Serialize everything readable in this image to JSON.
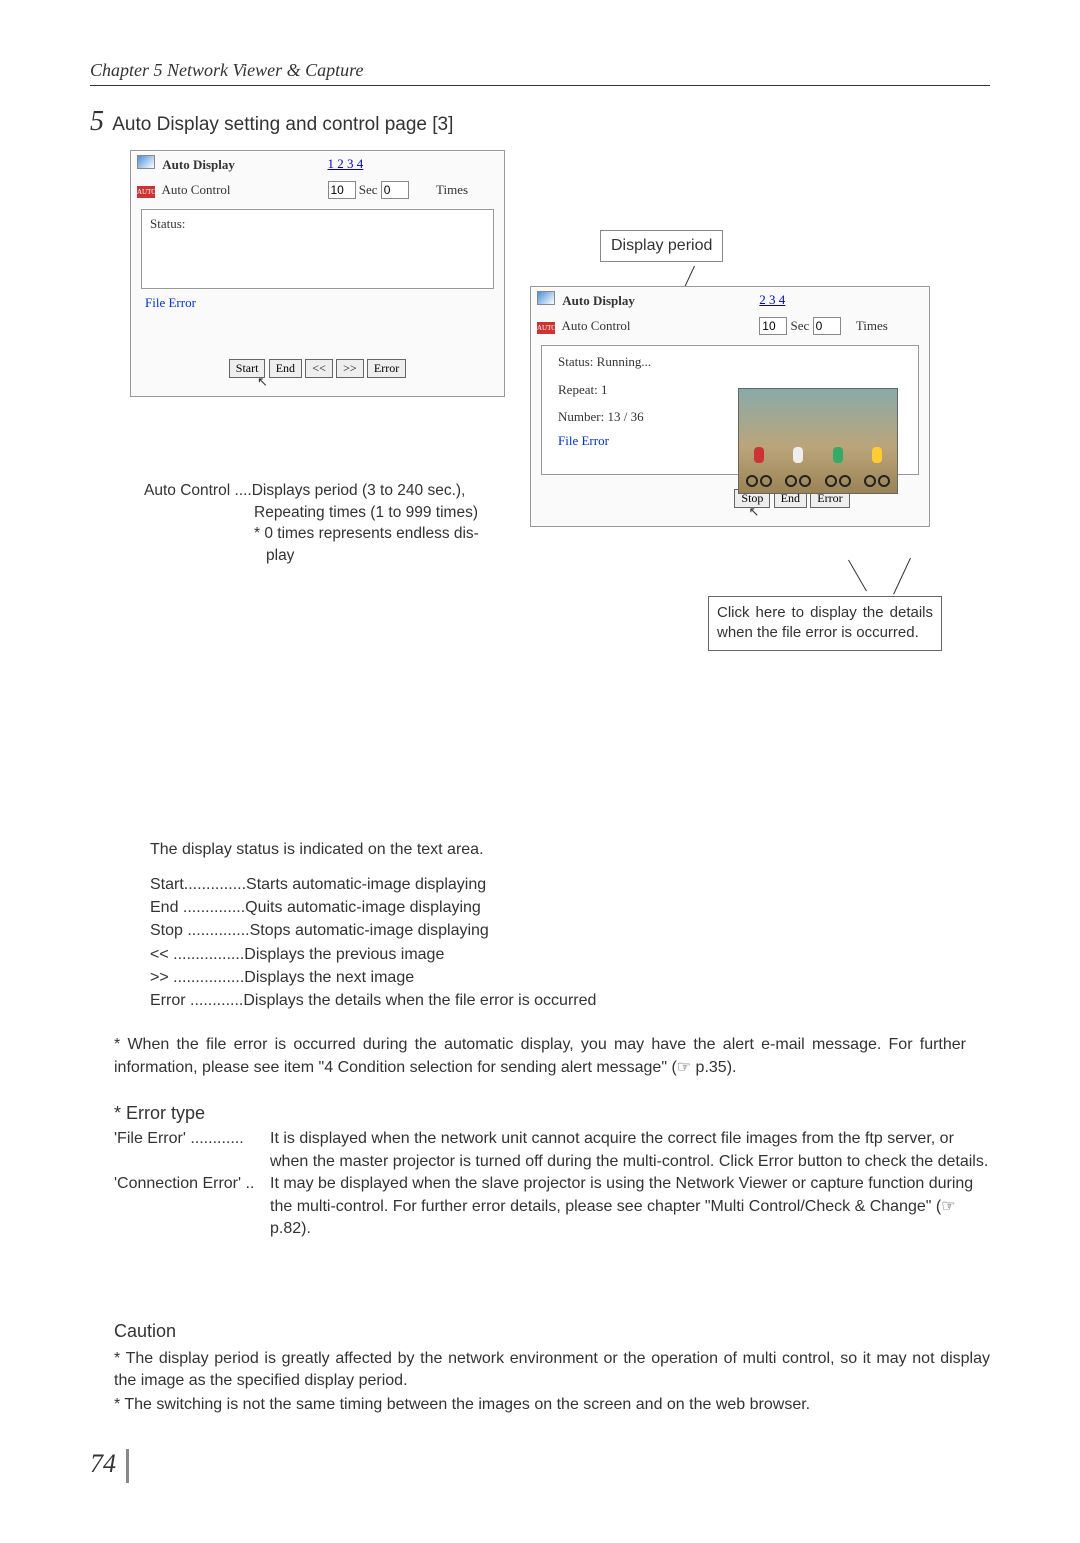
{
  "chapter": "Chapter 5 Network Viewer & Capture",
  "step": "5",
  "heading": "Auto Display setting and control page [3]",
  "panelA": {
    "title": "Auto Display",
    "pages": "1 2 3 4",
    "autoCtrl": "Auto Control",
    "secVal": "10",
    "secLbl": "Sec",
    "timesVal": "0",
    "timesLbl": "Times",
    "statusLabel": "Status:",
    "fileError": "File Error",
    "btns": {
      "start": "Start",
      "end": "End",
      "prev": "<<",
      "next": ">>",
      "error": "Error"
    }
  },
  "displayPeriodLabel": "Display period",
  "panelB": {
    "title": "Auto Display",
    "pages": "2 3 4",
    "autoCtrl": "Auto Control",
    "secVal": "10",
    "secLbl": "Sec",
    "timesVal": "0",
    "timesLbl": "Times",
    "statusRunning": "Status:  Running...",
    "repeat": "Repeat:  1",
    "number": "Number:  13 / 36",
    "fileError": "File Error",
    "btns": {
      "stop": "Stop",
      "end": "End",
      "error": "Error"
    }
  },
  "autoControlDef": {
    "l1": "Auto Control ....Displays period (3 to 240 sec.),",
    "l2": "Repeating times (1 to 999 times)",
    "l3": "* 0 times represents endless dis-",
    "l4": "play"
  },
  "statusNote": "The display status is indicated on the text area.",
  "errorCallout": "Click here to display the details when the file error is occurred.",
  "buttonDefs": {
    "r1": "Start..............Starts automatic-image displaying",
    "r2": "End ..............Quits automatic-image displaying",
    "r3": "Stop ..............Stops automatic-image displaying",
    "r4": "<< ................Displays the previous image",
    "r5": ">> ................Displays the next image",
    "r6": "Error ............Displays the details when the file error is occurred"
  },
  "footnote": "* When the file error is occurred during the automatic display, you may have the alert e-mail message. For further information, please see item \"4 Condition selection for sending alert message\" (☞ p.35).",
  "errorType": {
    "title": "* Error type",
    "fileErrorLbl": "'File Error' ............",
    "fileErrorDesc": "It is displayed when the network unit cannot acquire the correct file images from the ftp server, or when the master projector is turned off during the multi-control. Click Error button to check the details.",
    "connErrorLbl": "'Connection Error' ..",
    "connErrorDesc": "It may be displayed when the slave projector is using the Network Viewer or capture function during the multi-control. For further error details, please see chapter \"Multi Control/Check & Change\" (☞ p.82)."
  },
  "caution": {
    "title": "Caution",
    "p1": "* The display period is greatly affected by the network environment or the operation of multi control, so it may not display the image as the specified display period.",
    "p2": "* The switching is not the same timing between the images on the screen and on the web browser."
  },
  "pageNumber": "74"
}
